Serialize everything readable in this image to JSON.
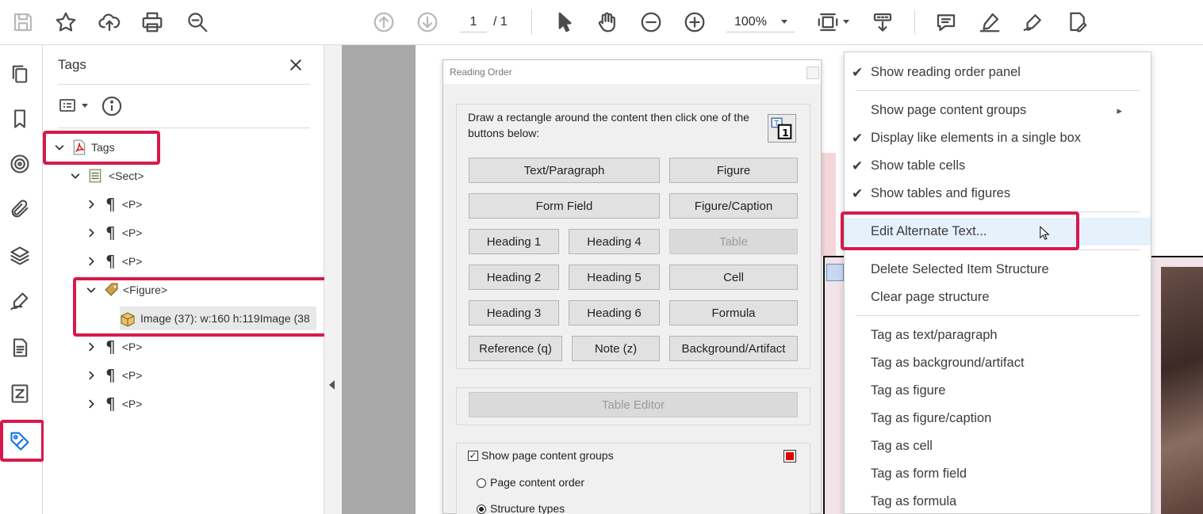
{
  "toolbar": {
    "page_current": "1",
    "page_total": "/ 1",
    "zoom": "100%",
    "icons": [
      "save-icon",
      "star-icon",
      "cloud-upload-icon",
      "print-icon",
      "zoom-search-icon",
      "prev-page-icon",
      "next-page-icon",
      "select-arrow-icon",
      "hand-icon",
      "zoom-out-icon",
      "zoom-in-icon",
      "fit-page-icon",
      "scroll-mode-icon",
      "comment-icon",
      "highlight-pen-icon",
      "sign-icon",
      "redact-icon"
    ]
  },
  "tags_panel": {
    "title": "Tags",
    "tree": [
      {
        "label": "Tags"
      },
      {
        "label": "<Sect>"
      },
      {
        "label": "<P>"
      },
      {
        "label": "<P>"
      },
      {
        "label": "<P>"
      },
      {
        "label": "<Figure>"
      },
      {
        "label": "Image (37): w:160 h:119Image (38"
      },
      {
        "label": "<P>"
      },
      {
        "label": "<P>"
      },
      {
        "label": "<P>"
      }
    ]
  },
  "reading_order": {
    "title": "Reading Order",
    "instruction": "Draw a rectangle around the content then click one of the buttons below:",
    "buttons": {
      "text_paragraph": "Text/Paragraph",
      "figure": "Figure",
      "form_field": "Form Field",
      "figure_caption": "Figure/Caption",
      "heading1": "Heading 1",
      "heading4": "Heading 4",
      "table": "Table",
      "heading2": "Heading 2",
      "heading5": "Heading 5",
      "cell": "Cell",
      "heading3": "Heading 3",
      "heading6": "Heading 6",
      "formula": "Formula",
      "reference": "Reference (q)",
      "note": "Note (z)",
      "background": "Background/Artifact",
      "table_editor": "Table Editor"
    },
    "show_groups_label": "Show page content groups",
    "show_groups_checked": true,
    "radio_page_order": "Page content order",
    "radio_structure": "Structure types",
    "selected_radio": "Structure types",
    "group_color": "#e00000"
  },
  "context_menu": {
    "items": [
      {
        "label": "Show reading order panel",
        "checked": true
      },
      {
        "label": "Show page content groups",
        "submenu": true
      },
      {
        "label": "Display like elements in a single box",
        "checked": true
      },
      {
        "label": "Show table cells",
        "checked": true
      },
      {
        "label": "Show tables and figures",
        "checked": true
      },
      {
        "label": "Edit Alternate Text...",
        "hovered": true
      },
      {
        "label": "Delete Selected Item Structure"
      },
      {
        "label": "Clear page structure"
      },
      {
        "label": "Tag as text/paragraph"
      },
      {
        "label": "Tag as background/artifact"
      },
      {
        "label": "Tag as figure"
      },
      {
        "label": "Tag as figure/caption"
      },
      {
        "label": "Tag as cell"
      },
      {
        "label": "Tag as form field"
      },
      {
        "label": "Tag as formula"
      }
    ],
    "check_glyph": "✔",
    "submenu_glyph": "▸"
  },
  "colors": {
    "highlight": "#d6194c",
    "hover_row": "#e5f1fb",
    "tag_blue": "#1473e6"
  }
}
